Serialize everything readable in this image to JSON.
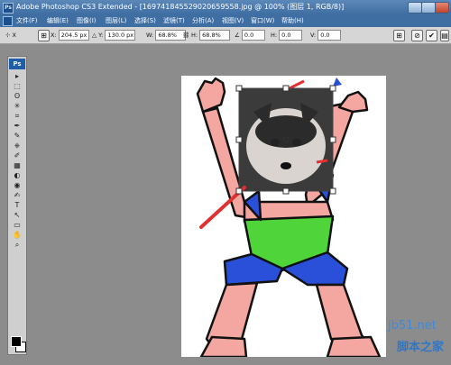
{
  "window": {
    "title": "Adobe Photoshop CS3 Extended - [169741845529020659558.jpg @ 100% (图层 1, RGB/8)]",
    "app_icon_text": "Ps"
  },
  "menu": {
    "items": [
      "文件(F)",
      "编辑(E)",
      "图像(I)",
      "图层(L)",
      "选择(S)",
      "滤镜(T)",
      "分析(A)",
      "视图(V)",
      "窗口(W)",
      "帮助(H)"
    ]
  },
  "options": {
    "x_label": "X:",
    "x_value": "204.5 px",
    "y_label": "Y:",
    "y_value": "130.0 px",
    "w_label": "W:",
    "w_value": "68.8%",
    "h_label": "H:",
    "h_value": "68.8%",
    "rotate_value": "0.0",
    "skew_h_label": "H:",
    "skew_h_value": "0.0",
    "skew_v_label": "V:",
    "skew_v_value": "0.0",
    "tool_preset": "X"
  },
  "toolbox": {
    "logo": "Ps",
    "tools": [
      "▸",
      "⬚",
      "ʘ",
      "✳",
      "⌗",
      "✒",
      "✎",
      "⎈",
      "✐",
      "▦",
      "◐",
      "◉",
      "✍",
      "T",
      "↖",
      "▭",
      "✋",
      "⌕"
    ]
  },
  "watermark": {
    "site": "jb51.net",
    "text": "脚本之家"
  },
  "colors": {
    "titlebar": "#4a79ad",
    "workspace": "#8c8c8c",
    "skin": "#f4a6a0",
    "shorts": "#2a4fd8",
    "belt": "#4fd43a"
  }
}
